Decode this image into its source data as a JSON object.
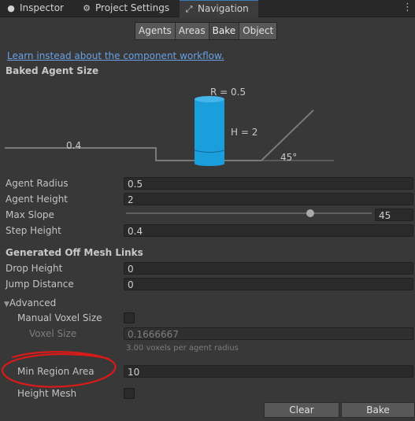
{
  "tabs": [
    {
      "label": "Inspector",
      "icon": "info-icon"
    },
    {
      "label": "Project Settings",
      "icon": "gear-icon"
    },
    {
      "label": "Navigation",
      "icon": "navigation-icon",
      "active": true
    }
  ],
  "toolbar": {
    "agents": "Agents",
    "areas": "Areas",
    "bake": "Bake",
    "object": "Object",
    "selected": "Bake"
  },
  "workflow_link": "Learn instead about the component workflow.",
  "baked_agent_size": {
    "header": "Baked Agent Size",
    "radius_label": "R = 0.5",
    "height_label": "H = 2",
    "step_label": "0.4",
    "slope_label": "45°"
  },
  "agent": {
    "radius_label": "Agent Radius",
    "radius_value": "0.5",
    "height_label": "Agent Height",
    "height_value": "2",
    "slope_label": "Max Slope",
    "slope_value": "45",
    "slope_fraction": 0.75,
    "step_label": "Step Height",
    "step_value": "0.4"
  },
  "offmesh": {
    "header": "Generated Off Mesh Links",
    "drop_label": "Drop Height",
    "drop_value": "0",
    "jump_label": "Jump Distance",
    "jump_value": "0"
  },
  "advanced": {
    "header": "Advanced",
    "manual_voxel_label": "Manual Voxel Size",
    "voxel_size_label": "Voxel Size",
    "voxel_size_value": "0.1666667",
    "voxel_hint": "3.00 voxels per agent radius",
    "min_region_label": "Min Region Area",
    "min_region_value": "10",
    "height_mesh_label": "Height Mesh"
  },
  "buttons": {
    "clear": "Clear",
    "bake": "Bake"
  },
  "colors": {
    "background": "#383838",
    "cylinder": "#1b9fdc",
    "annotation": "#d81a1a",
    "link": "#6aa0e4",
    "active_tab": "#3a79bb"
  }
}
